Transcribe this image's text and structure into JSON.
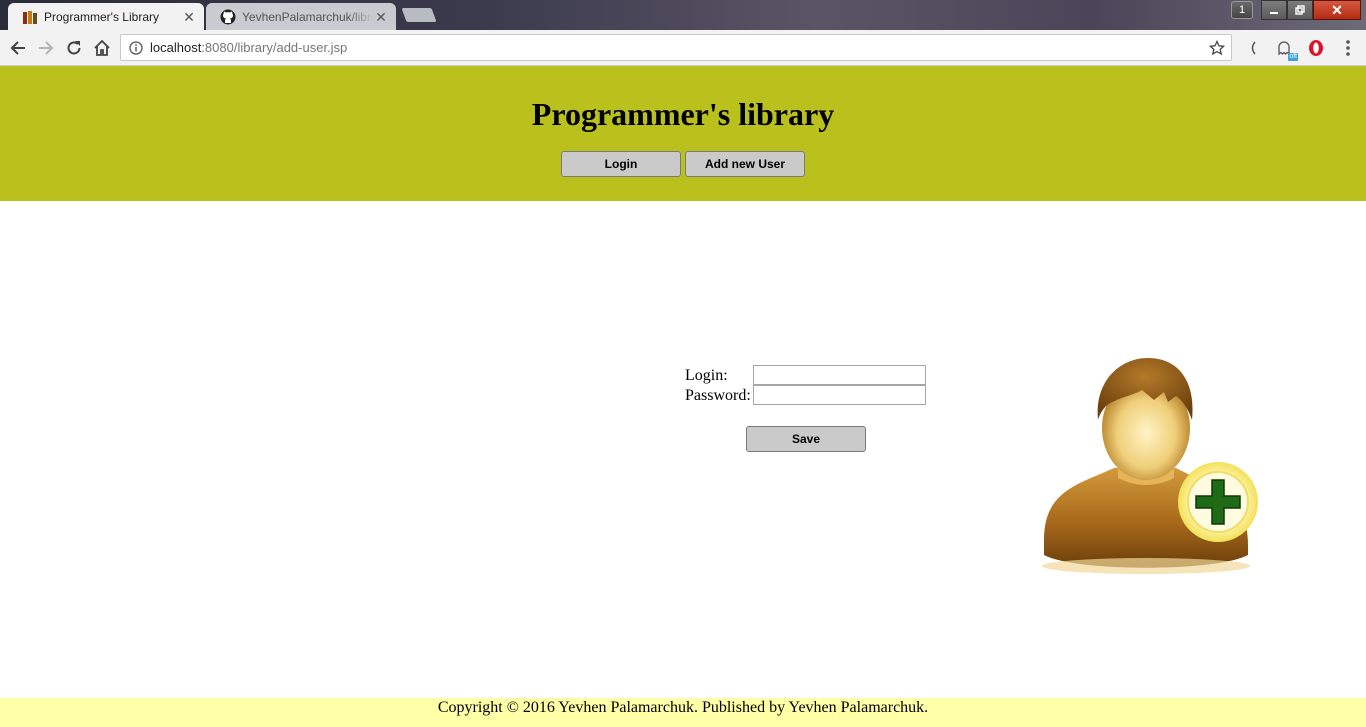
{
  "browser": {
    "tabs": [
      {
        "title": "Programmer's Library",
        "active": true,
        "favicon": "library-favicon-icon"
      },
      {
        "title": "YevhenPalamarchuk/library",
        "active": false,
        "favicon": "github-icon"
      }
    ],
    "window_controls": {
      "profile_label": "1"
    },
    "url": {
      "host": "localhost",
      "rest": ":8080/library/add-user.jsp"
    },
    "extensions": [
      {
        "name": "bracket-extension-icon"
      },
      {
        "name": "ghostery-icon",
        "badge": "off"
      },
      {
        "name": "opera-vpn-icon"
      },
      {
        "name": "chrome-menu-icon"
      }
    ]
  },
  "header": {
    "title": "Programmer's library",
    "nav": {
      "login_label": "Login",
      "add_user_label": "Add new User"
    },
    "background": "#bbc11c"
  },
  "form": {
    "login_label": "Login:",
    "password_label": "Password:",
    "login_value": "",
    "password_value": "",
    "save_label": "Save"
  },
  "illustration": {
    "icon": "add-user-icon"
  },
  "footer": {
    "text": "Copyright © 2016 Yevhen Palamarchuk. Published by Yevhen Palamarchuk.",
    "background": "#ffffa8"
  }
}
